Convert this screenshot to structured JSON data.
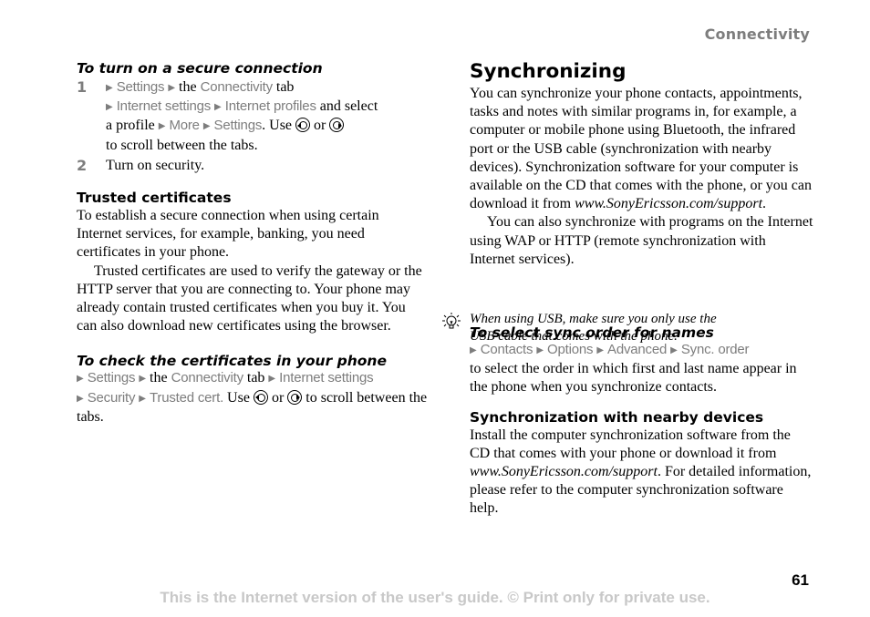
{
  "header": {
    "chapter": "Connectivity"
  },
  "left": {
    "secure_connection": {
      "heading": "To turn on a secure connection",
      "steps": [
        {
          "number": "1",
          "parts": {
            "settings": "Settings",
            "the": "the",
            "connectivity": "Connectivity",
            "tab": "tab",
            "internet_settings": "Internet settings",
            "internet_profiles": "Internet profiles",
            "and_select": "and select",
            "a_profile": "a profile",
            "more": "More",
            "settings2": "Settings",
            "use": ". Use",
            "or": "or",
            "scroll": "to scroll between the tabs."
          }
        },
        {
          "number": "2",
          "text": "Turn on security."
        }
      ]
    },
    "trusted": {
      "heading": "Trusted certificates",
      "para1": "To establish a secure connection when using certain Internet services, for example, banking, you need certificates in your phone.",
      "para2": "Trusted certificates are used to verify the gateway or the HTTP server that you are connecting to. Your phone may already contain trusted certificates when you buy it. You can also download new certificates using the browser."
    },
    "check": {
      "heading": "To check the certificates in your phone",
      "parts": {
        "settings": "Settings",
        "the": "the",
        "connectivity": "Connectivity",
        "tab": "tab",
        "internet_settings": "Internet settings",
        "security": "Security",
        "trusted_cert": "Trusted cert.",
        "use": "Use",
        "or": "or",
        "scroll": "to scroll between the tabs."
      }
    }
  },
  "right": {
    "title": "Synchronizing",
    "para1": "You can synchronize your phone contacts, appointments, tasks and notes with similar programs in, for example, a computer or mobile phone using Bluetooth, the infrared port or the USB cable (synchronization with nearby devices). Synchronization software for your computer is available on the CD that comes with the phone, or you can download it from",
    "url": "www.SonyEricsson.com/support",
    "para1_end": ".",
    "para2": "You can also synchronize with programs on the Internet using WAP or HTTP (remote synchronization with Internet services).",
    "tip": "When using USB, make sure you only use the USB cable that comes with the phone.",
    "sync_order": {
      "heading": "To select sync order for names",
      "path": [
        "Contacts",
        "Options",
        "Advanced",
        "Sync. order"
      ],
      "text": "to select the order in which first and last name appear in the phone when you synchronize contacts."
    },
    "nearby": {
      "heading": "Synchronization with nearby devices",
      "text_before": "Install the computer synchronization software from the CD that comes with your phone or download it from",
      "url": "www.SonyEricsson.com/support",
      "text_after": ". For detailed information, please refer to the computer synchronization software help."
    }
  },
  "footer": {
    "page_number": "61",
    "notice": "This is the Internet version of the user's guide. © Print only for private use."
  },
  "icons": {
    "arrow": "▶"
  }
}
